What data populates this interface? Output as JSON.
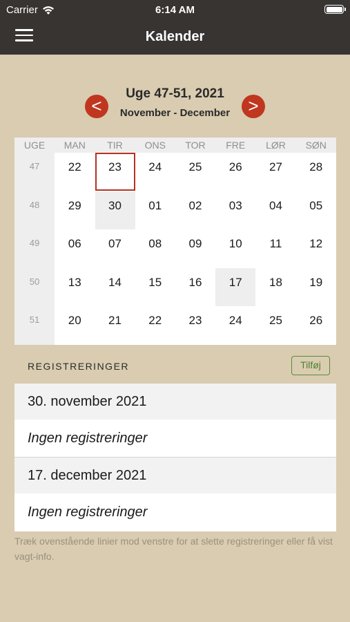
{
  "status": {
    "carrier": "Carrier",
    "time": "6:14 AM"
  },
  "nav": {
    "title": "Kalender"
  },
  "week": {
    "range": "Uge 47-51, 2021",
    "months": "November - December",
    "prev_label": "<",
    "next_label": ">"
  },
  "calendar": {
    "headers": [
      "UGE",
      "MAN",
      "TIR",
      "ONS",
      "TOR",
      "FRE",
      "LØR",
      "SØN"
    ],
    "rows": [
      {
        "week": "47",
        "days": [
          "22",
          "23",
          "24",
          "25",
          "26",
          "27",
          "28"
        ]
      },
      {
        "week": "48",
        "days": [
          "29",
          "30",
          "01",
          "02",
          "03",
          "04",
          "05"
        ]
      },
      {
        "week": "49",
        "days": [
          "06",
          "07",
          "08",
          "09",
          "10",
          "11",
          "12"
        ]
      },
      {
        "week": "50",
        "days": [
          "13",
          "14",
          "15",
          "16",
          "17",
          "18",
          "19"
        ]
      },
      {
        "week": "51",
        "days": [
          "20",
          "21",
          "22",
          "23",
          "24",
          "25",
          "26"
        ]
      }
    ]
  },
  "registrations": {
    "header": "REGISTRERINGER",
    "add_label": "Tilføj",
    "items": [
      {
        "date": "30. november 2021",
        "text": "Ingen registreringer"
      },
      {
        "date": "17. december 2021",
        "text": "Ingen registreringer"
      }
    ]
  },
  "hint": "Træk ovenstående linier mod venstre for at slette registreringer eller få vist vagt-info.",
  "colors": {
    "nav_bg": "#373432",
    "page_bg": "#d9ccb0",
    "accent_red": "#c0361f",
    "add_green": "#4f8030"
  }
}
